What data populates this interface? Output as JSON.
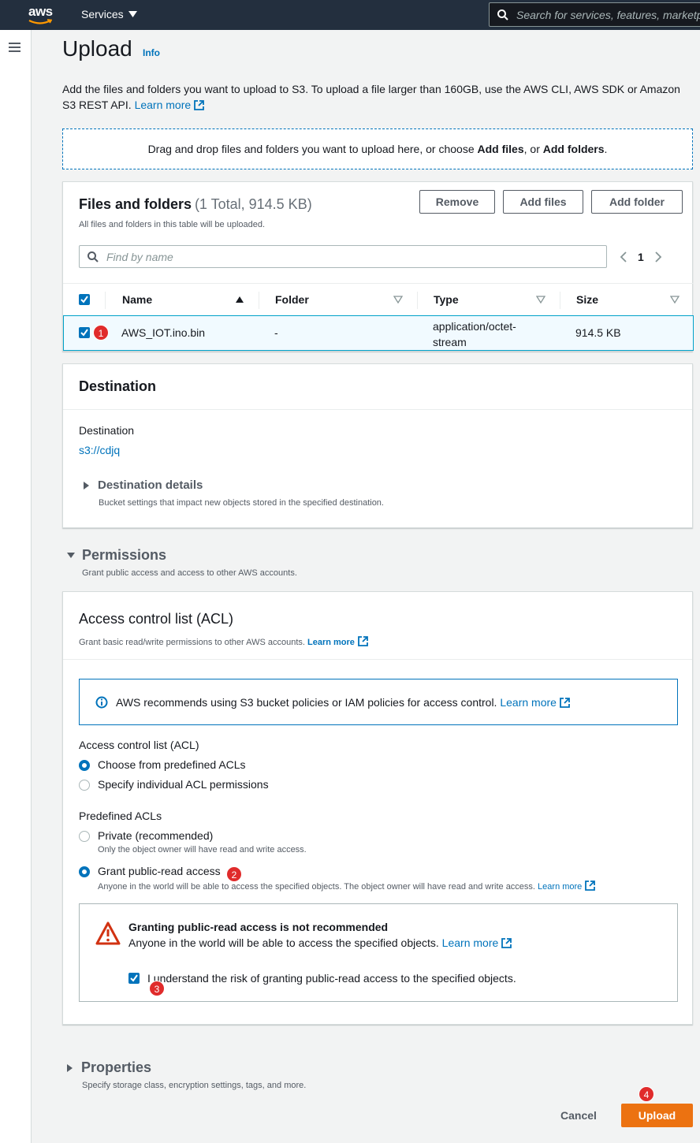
{
  "topbar": {
    "logo_text": "aws",
    "services_label": "Services",
    "search_placeholder": "Search for services, features, marketplace products, and docs"
  },
  "page": {
    "title": "Upload",
    "info_label": "Info",
    "intro_text": "Add the files and folders you want to upload to S3. To upload a file larger than 160GB, use the AWS CLI, AWS SDK or Amazon S3 REST API.",
    "intro_link": "Learn more",
    "dropzone_prefix": "Drag and drop files and folders you want to upload here, or choose ",
    "dropzone_add_files": "Add files",
    "dropzone_middle": ", or ",
    "dropzone_add_folders": "Add folders",
    "dropzone_suffix": "."
  },
  "files": {
    "title": "Files and folders",
    "count": "(1 Total, 914.5 KB)",
    "subtitle": "All files and folders in this table will be uploaded.",
    "remove_label": "Remove",
    "add_files_label": "Add files",
    "add_folder_label": "Add folder",
    "find_placeholder": "Find by name",
    "page_number": "1",
    "columns": [
      "Name",
      "Folder",
      "Type",
      "Size"
    ],
    "rows": [
      {
        "badge": "1",
        "name": "AWS_IOT.ino.bin",
        "folder": "-",
        "type_line1": "application/octet-",
        "type_line2": "stream",
        "size": "914.5 KB"
      }
    ]
  },
  "destination": {
    "title": "Destination",
    "label": "Destination",
    "value": "s3://cdjq",
    "details_title": "Destination details",
    "details_desc": "Bucket settings that impact new objects stored in the specified destination."
  },
  "permissions": {
    "title": "Permissions",
    "desc": "Grant public access and access to other AWS accounts.",
    "acl_title": "Access control list (ACL)",
    "acl_desc": "Grant basic read/write permissions to other AWS accounts.",
    "acl_learn_more": "Learn more",
    "alert_text": "AWS recommends using S3 bucket policies or IAM policies for access control.",
    "alert_learn_more": "Learn more",
    "acl_group_label": "Access control list (ACL)",
    "acl_option_predefined": "Choose from predefined ACLs",
    "acl_option_individual": "Specify individual ACL permissions",
    "predefined_label": "Predefined ACLs",
    "private_label": "Private (recommended)",
    "private_desc": "Only the object owner will have read and write access.",
    "public_label": "Grant public-read access",
    "public_desc": "Anyone in the world will be able to access the specified objects. The object owner will have read and write access.",
    "public_learn_more": "Learn more",
    "badge2": "2",
    "warning_title": "Granting public-read access is not recommended",
    "warning_text": "Anyone in the world will be able to access the specified objects.",
    "warning_learn_more": "Learn more",
    "ack_label": "I understand the risk of granting public-read access to the specified objects.",
    "badge3": "3"
  },
  "properties": {
    "title": "Properties",
    "desc": "Specify storage class, encryption settings, tags, and more."
  },
  "footer": {
    "cancel_label": "Cancel",
    "upload_label": "Upload",
    "badge4": "4"
  },
  "colors": {
    "accent": "#0073bb",
    "upload_button": "#ec7211",
    "badge": "#e02b2b",
    "warning": "#d13212"
  }
}
